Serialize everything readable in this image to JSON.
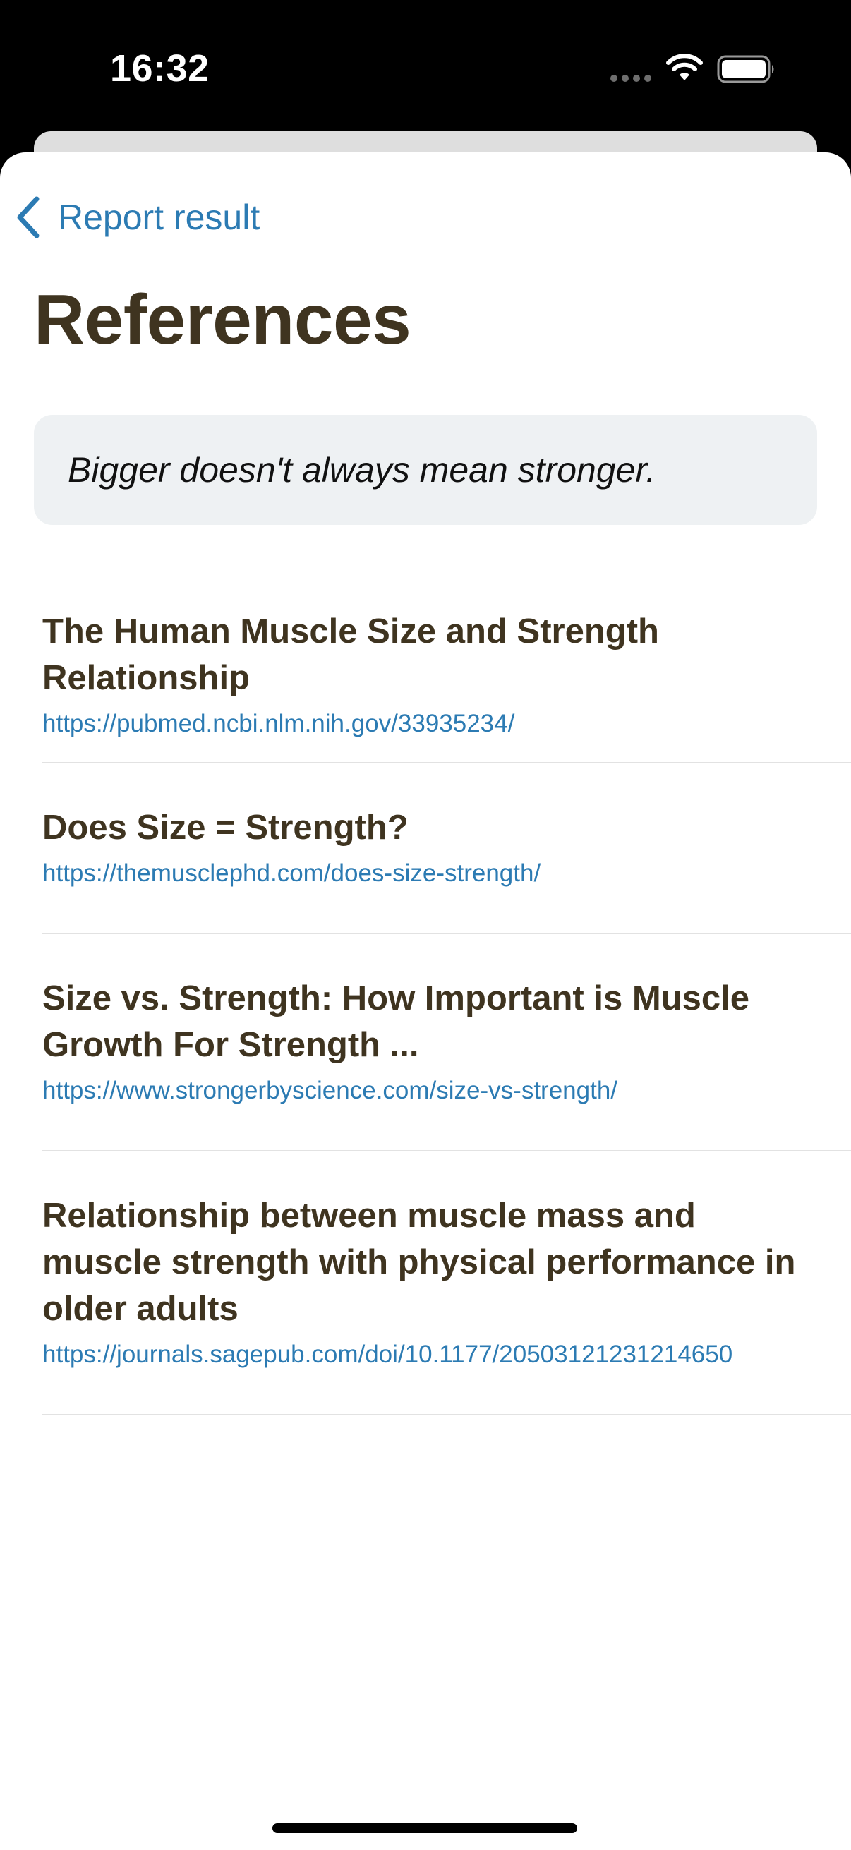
{
  "status_bar": {
    "time": "16:32"
  },
  "nav": {
    "back_label": "Report result",
    "back_icon": "chevron-left-icon"
  },
  "page": {
    "title": "References",
    "quote": "Bigger doesn't always mean stronger."
  },
  "references": [
    {
      "title": "The Human Muscle Size and Strength Relationship",
      "url": "https://pubmed.ncbi.nlm.nih.gov/33935234/"
    },
    {
      "title": "Does Size = Strength?",
      "url": "https://themusclephd.com/does-size-strength/"
    },
    {
      "title": "Size vs. Strength: How Important is Muscle Growth For Strength ...",
      "url": "https://www.strongerbyscience.com/size-vs-strength/"
    },
    {
      "title": "Relationship between muscle mass and muscle strength with physical performance in older adults",
      "url": "https://journals.sagepub.com/doi/10.1177/20503121231214650"
    }
  ],
  "colors": {
    "accent": "#2c7bb3",
    "title_text": "#3f3420",
    "quote_bg": "#eef1f3",
    "divider": "#e2e2e2"
  }
}
